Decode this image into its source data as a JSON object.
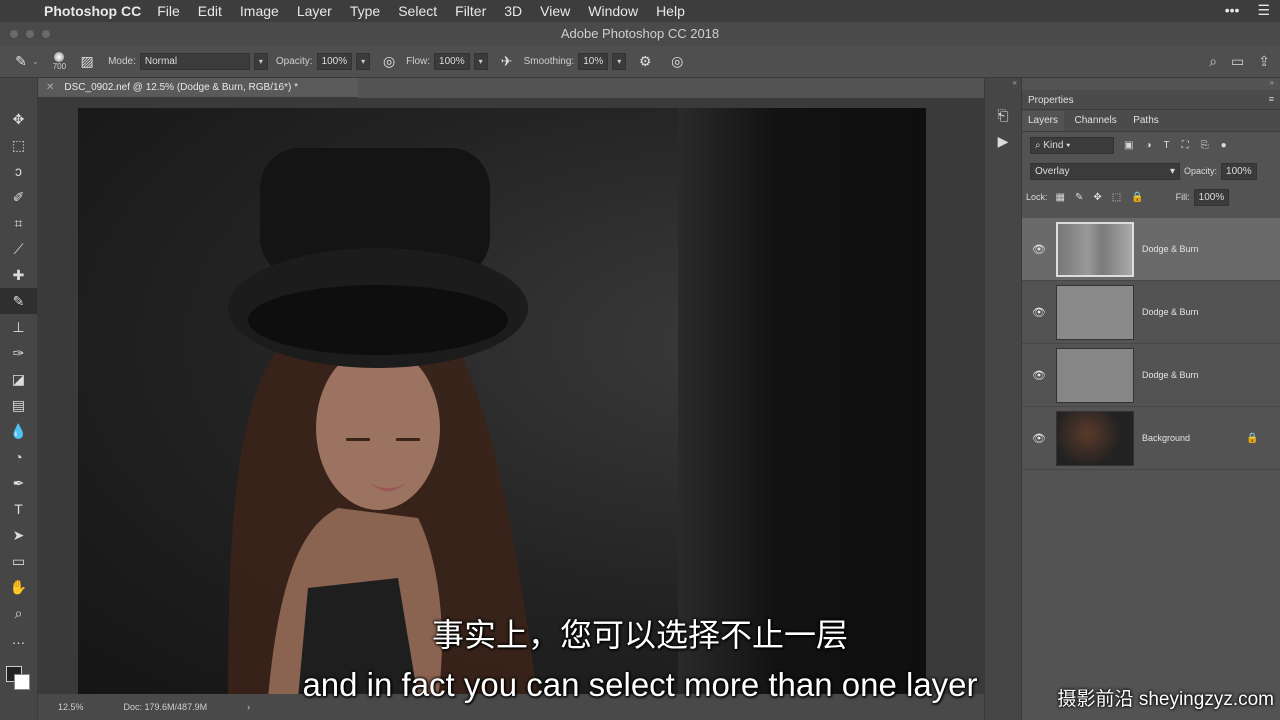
{
  "menubar": {
    "app": "Photoshop CC",
    "items": [
      "File",
      "Edit",
      "Image",
      "Layer",
      "Type",
      "Select",
      "Filter",
      "3D",
      "View",
      "Window",
      "Help"
    ]
  },
  "window": {
    "title": "Adobe Photoshop CC 2018"
  },
  "options": {
    "brush_size": "700",
    "mode_label": "Mode:",
    "mode_value": "Normal",
    "opacity_label": "Opacity:",
    "opacity_value": "100%",
    "flow_label": "Flow:",
    "flow_value": "100%",
    "smoothing_label": "Smoothing:",
    "smoothing_value": "10%"
  },
  "document": {
    "tab_title": "DSC_0902.nef @ 12.5% (Dodge & Burn, RGB/16*) *",
    "zoom": "12.5%",
    "doc_size": "Doc: 179.6M/487.9M"
  },
  "panels": {
    "properties": "Properties",
    "tabs": [
      "Layers",
      "Channels",
      "Paths"
    ],
    "kind_label": "Kind",
    "blend_mode": "Overlay",
    "opacity_label": "Opacity:",
    "opacity_value": "100%",
    "lock_label": "Lock:",
    "fill_label": "Fill:",
    "fill_value": "100%"
  },
  "layers": [
    {
      "name": "Dodge & Burn",
      "selected": true
    },
    {
      "name": "Dodge & Burn",
      "selected": false
    },
    {
      "name": "Dodge & Burn",
      "selected": false
    },
    {
      "name": "Background",
      "selected": false,
      "locked": true
    }
  ],
  "subtitles": {
    "chinese": "事实上，您可以选择不止一层",
    "english": "and in fact you can select more than one layer"
  },
  "watermark": "摄影前沿 sheyingzyz.com",
  "icons": [
    "apple-icon",
    "brush-icon",
    "gear-icon",
    "search-icon",
    "eye-icon",
    "lock-icon",
    "play-icon",
    "history-icon"
  ]
}
